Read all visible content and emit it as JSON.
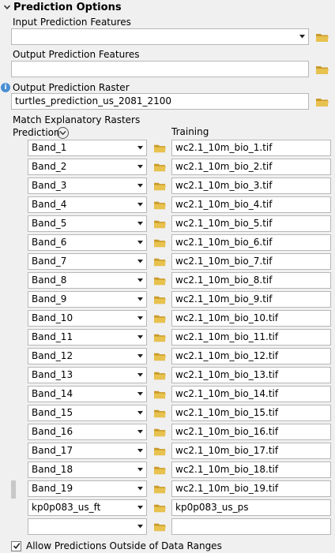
{
  "section": {
    "title": "Prediction Options"
  },
  "input_features": {
    "label": "Input Prediction Features",
    "value": ""
  },
  "output_features": {
    "label": "Output Prediction Features",
    "value": ""
  },
  "output_raster": {
    "label": "Output Prediction Raster",
    "value": "turtles_prediction_us_2081_2100"
  },
  "match": {
    "title": "Match Explanatory Rasters",
    "prediction_header": "Prediction",
    "training_header": "Training",
    "rows": [
      {
        "prediction": "Band_1",
        "training": "wc2.1_10m_bio_1.tif"
      },
      {
        "prediction": "Band_2",
        "training": "wc2.1_10m_bio_2.tif"
      },
      {
        "prediction": "Band_3",
        "training": "wc2.1_10m_bio_3.tif"
      },
      {
        "prediction": "Band_4",
        "training": "wc2.1_10m_bio_4.tif"
      },
      {
        "prediction": "Band_5",
        "training": "wc2.1_10m_bio_5.tif"
      },
      {
        "prediction": "Band_6",
        "training": "wc2.1_10m_bio_6.tif"
      },
      {
        "prediction": "Band_7",
        "training": "wc2.1_10m_bio_7.tif"
      },
      {
        "prediction": "Band_8",
        "training": "wc2.1_10m_bio_8.tif"
      },
      {
        "prediction": "Band_9",
        "training": "wc2.1_10m_bio_9.tif"
      },
      {
        "prediction": "Band_10",
        "training": "wc2.1_10m_bio_10.tif"
      },
      {
        "prediction": "Band_11",
        "training": "wc2.1_10m_bio_11.tif"
      },
      {
        "prediction": "Band_12",
        "training": "wc2.1_10m_bio_12.tif"
      },
      {
        "prediction": "Band_13",
        "training": "wc2.1_10m_bio_13.tif"
      },
      {
        "prediction": "Band_14",
        "training": "wc2.1_10m_bio_14.tif"
      },
      {
        "prediction": "Band_15",
        "training": "wc2.1_10m_bio_15.tif"
      },
      {
        "prediction": "Band_16",
        "training": "wc2.1_10m_bio_16.tif"
      },
      {
        "prediction": "Band_17",
        "training": "wc2.1_10m_bio_17.tif"
      },
      {
        "prediction": "Band_18",
        "training": "wc2.1_10m_bio_18.tif"
      },
      {
        "prediction": "Band_19",
        "training": "wc2.1_10m_bio_19.tif"
      },
      {
        "prediction": "kp0p083_us_ft",
        "training": "kp0p083_us_ps"
      },
      {
        "prediction": "",
        "training": ""
      }
    ]
  },
  "allow_outside": {
    "label": "Allow Predictions Outside of Data Ranges",
    "checked": true
  },
  "icons": {
    "section_toggle": "chevron-down-icon",
    "folder": "folder-icon",
    "dropdown": "dropdown-arrow-icon",
    "info": "info-icon",
    "expand": "expand-circle-icon",
    "check": "checkmark-icon"
  },
  "colors": {
    "folder": "#dcb43c",
    "info": "#4a8fd4"
  }
}
